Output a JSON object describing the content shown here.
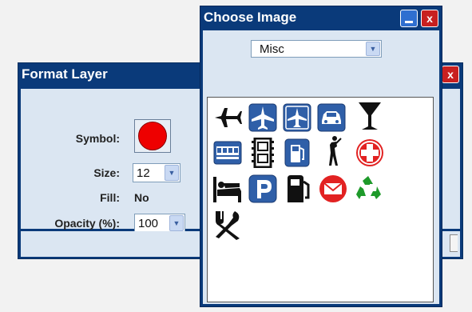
{
  "format_layer": {
    "title": "Format Layer",
    "close_label": "x",
    "symbol_label": "Symbol:",
    "symbol_color": "#ee0000",
    "size_label": "Size:",
    "size_value": "12",
    "fill_label": "Fill:",
    "fill_value": "No",
    "opacity_label": "Opacity (%):",
    "opacity_value": "100"
  },
  "choose_image": {
    "title": "Choose Image",
    "close_label": "x",
    "category": "Misc",
    "icons": [
      "airplane-icon",
      "airport-blue-icon",
      "airport-alt-icon",
      "car-icon",
      "cocktail-icon",
      "bus-icon",
      "film-icon",
      "gas-pump-icon",
      "golf-icon",
      "first-aid-icon",
      "bed-icon",
      "parking-icon",
      "fuel-icon",
      "mail-icon",
      "recycle-icon",
      "restaurant-icon"
    ]
  }
}
